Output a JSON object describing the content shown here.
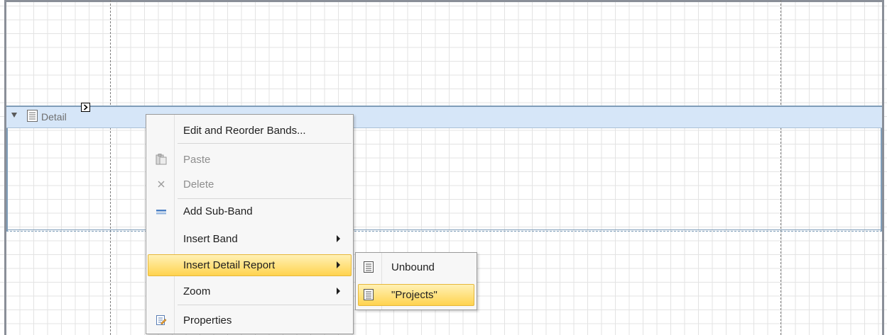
{
  "band": {
    "label": "Detail",
    "icon": "band-page-icon",
    "collapse_icon": "triangle-down-icon",
    "smart_tag_icon": "smart-tag-arrow-icon"
  },
  "context_menu": {
    "items": [
      {
        "label": "Edit and Reorder Bands...",
        "icon": null,
        "disabled": false
      },
      {
        "label": "Paste",
        "icon": "paste-icon",
        "disabled": true
      },
      {
        "label": "Delete",
        "icon": "delete-x-icon",
        "disabled": true
      },
      {
        "label": "Add Sub-Band",
        "icon": "sub-band-icon",
        "disabled": false
      },
      {
        "label": "Insert Band",
        "icon": null,
        "disabled": false,
        "submenu": true
      },
      {
        "label": "Insert Detail Report",
        "icon": null,
        "disabled": false,
        "submenu": true,
        "highlighted": true
      },
      {
        "label": "Zoom",
        "icon": null,
        "disabled": false,
        "submenu": true
      },
      {
        "label": "Properties",
        "icon": "properties-icon",
        "disabled": false
      }
    ]
  },
  "submenu": {
    "items": [
      {
        "label": "Unbound",
        "icon": "report-page-icon"
      },
      {
        "label": "\"Projects\"",
        "icon": "report-page-icon",
        "highlighted": true
      }
    ]
  },
  "colors": {
    "band_header": "#d6e6f8",
    "band_border": "#7f9db9",
    "highlight_top": "#fff1b5",
    "highlight_bottom": "#ffd34f",
    "sub_band_icon": "#4a7fc4"
  }
}
